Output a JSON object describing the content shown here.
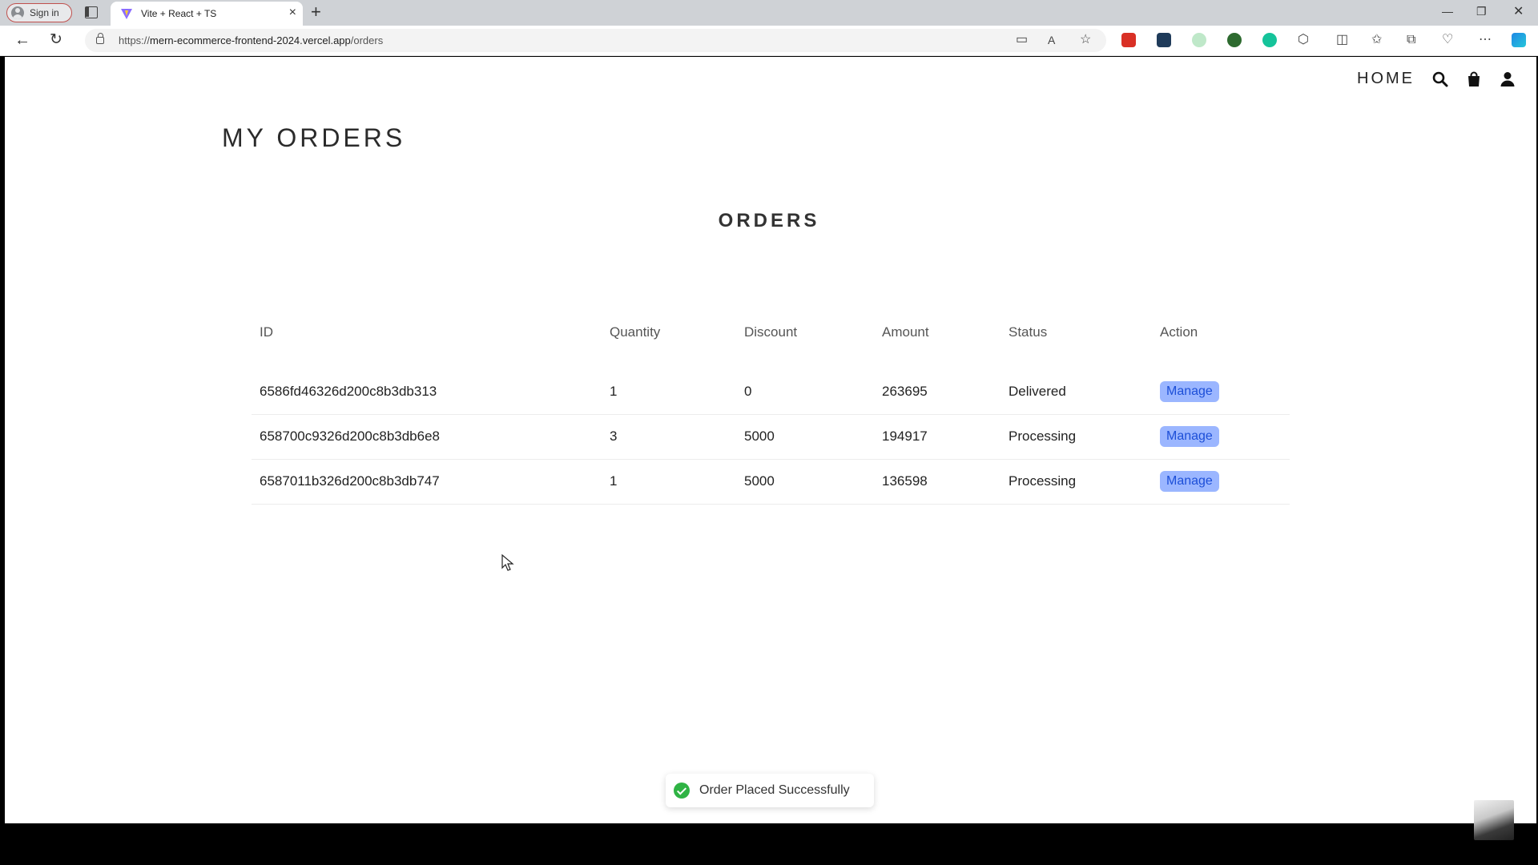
{
  "browser": {
    "signin_label": "Sign in",
    "tab_title": "Vite + React + TS",
    "url_prefix": "https://",
    "url_host": "mern-ecommerce-frontend-2024.vercel.app",
    "url_path": "/orders"
  },
  "nav": {
    "home_label": "HOME"
  },
  "page": {
    "title": "MY ORDERS",
    "table_heading": "ORDERS"
  },
  "table": {
    "headers": [
      "ID",
      "Quantity",
      "Discount",
      "Amount",
      "Status",
      "Action"
    ],
    "rows": [
      {
        "id": "6586fd46326d200c8b3db313",
        "quantity": "1",
        "discount": "0",
        "amount": "263695",
        "status": "Delivered",
        "action": "Manage"
      },
      {
        "id": "658700c9326d200c8b3db6e8",
        "quantity": "3",
        "discount": "5000",
        "amount": "194917",
        "status": "Processing",
        "action": "Manage"
      },
      {
        "id": "6587011b326d200c8b3db747",
        "quantity": "1",
        "discount": "5000",
        "amount": "136598",
        "status": "Processing",
        "action": "Manage"
      }
    ]
  },
  "toast": {
    "message": "Order Placed Successfully"
  },
  "colors": {
    "delivered": "#4b4bd6",
    "processing": "#e0363c",
    "manage_bg": "#9bb6ff",
    "toast_success": "#2fb344"
  }
}
